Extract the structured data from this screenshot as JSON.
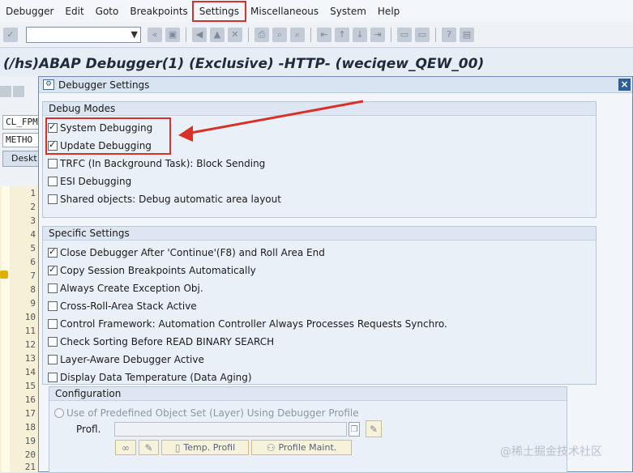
{
  "menubar": {
    "items": [
      "Debugger",
      "Edit",
      "Goto",
      "Breakpoints",
      "Settings",
      "Miscellaneous",
      "System",
      "Help"
    ],
    "active_index": 4
  },
  "toolbar": {
    "command_field_value": "",
    "icons": [
      "enter-icon",
      "dropdown-icon",
      "back-icon",
      "save-icon",
      "back-nav-icon",
      "exit-icon",
      "cancel-icon",
      "print-icon",
      "find-icon",
      "find-next-icon",
      "first-page-icon",
      "prev-page-icon",
      "next-page-icon",
      "last-page-icon",
      "new-session-icon",
      "shortcut-icon",
      "help-icon",
      "layout-icon"
    ]
  },
  "app": {
    "title": "(/hs)ABAP Debugger(1)  (Exclusive) -HTTP- (weciqew_QEW_00)"
  },
  "background": {
    "field1": "CL_FPM",
    "field2": "METHO",
    "tab": "Deskt",
    "line_numbers": [
      "1",
      "2",
      "3",
      "4",
      "5",
      "6",
      "7",
      "8",
      "9",
      "10",
      "11",
      "12",
      "13",
      "14",
      "15",
      "16",
      "17",
      "18",
      "19",
      "20",
      "21"
    ]
  },
  "dialog": {
    "title": "Debugger Settings",
    "close": "×",
    "debug_modes": {
      "title": "Debug Modes",
      "options": [
        {
          "label": "System Debugging",
          "checked": true
        },
        {
          "label": "Update Debugging",
          "checked": true
        },
        {
          "label": "TRFC (In Background Task): Block Sending",
          "checked": false
        },
        {
          "label": "ESI Debugging",
          "checked": false
        },
        {
          "label": "Shared objects: Debug automatic area layout",
          "checked": false
        }
      ]
    },
    "specific_settings": {
      "title": "Specific Settings",
      "options": [
        {
          "label": "Close Debugger After 'Continue'(F8) and Roll Area End",
          "checked": true
        },
        {
          "label": "Copy Session Breakpoints Automatically",
          "checked": true
        },
        {
          "label": "Always Create Exception Obj.",
          "checked": false
        },
        {
          "label": "Cross-Roll-Area Stack Active",
          "checked": false
        },
        {
          "label": "Control Framework: Automation Controller Always Processes Requests Synchro.",
          "checked": false
        },
        {
          "label": "Check Sorting Before READ BINARY SEARCH",
          "checked": false
        },
        {
          "label": "Layer-Aware Debugger Active",
          "checked": false
        },
        {
          "label": "Display Data Temperature (Data Aging)",
          "checked": false
        }
      ]
    },
    "configuration": {
      "title": "Configuration",
      "radio_label": "Use of Predefined Object Set (Layer) Using Debugger Profile",
      "profl_label": "Profl.",
      "profl_value": "",
      "buttons": {
        "temp_profil": "Temp. Profil",
        "profile_maint": "Profile Maint."
      }
    }
  },
  "watermark": "@稀土掘金技术社区",
  "colors": {
    "highlight_red": "#d9302a",
    "dialog_border": "#6b88ad",
    "close_button": "#2f5f9a"
  }
}
